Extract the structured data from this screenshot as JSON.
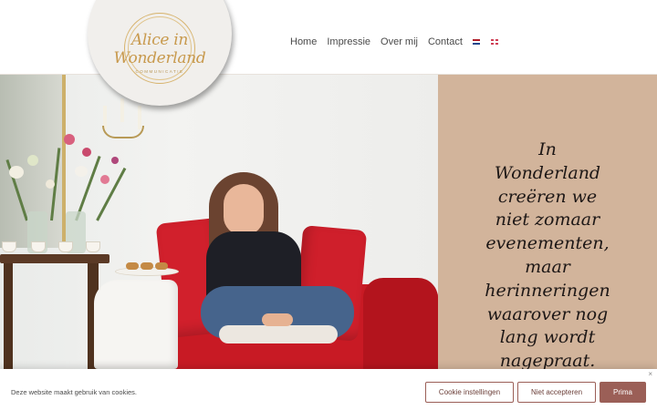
{
  "logo": {
    "title": "Alice in Wonderland",
    "subtitle": "COMMUNICATIE"
  },
  "nav": {
    "items": [
      {
        "label": "Home"
      },
      {
        "label": "Impressie"
      },
      {
        "label": "Over mij"
      },
      {
        "label": "Contact"
      }
    ],
    "languages": [
      {
        "icon": "flag-nl-icon"
      },
      {
        "icon": "flag-en-icon"
      }
    ]
  },
  "quote": {
    "lines": [
      "In",
      "Wonderland",
      "creëren we",
      "niet zomaar",
      "evenementen,",
      "maar",
      "herinneringen",
      "waarover nog",
      "lang wordt",
      "nagepraat."
    ]
  },
  "cookie": {
    "text": "Deze website maakt gebruik van cookies.",
    "settings_label": "Cookie instellingen",
    "reject_label": "Niet accepteren",
    "accept_label": "Prima",
    "close_label": "×"
  },
  "colors": {
    "panel": "#d2b49b",
    "button": "#9b5f57",
    "logo_gold": "#c89a4e"
  }
}
